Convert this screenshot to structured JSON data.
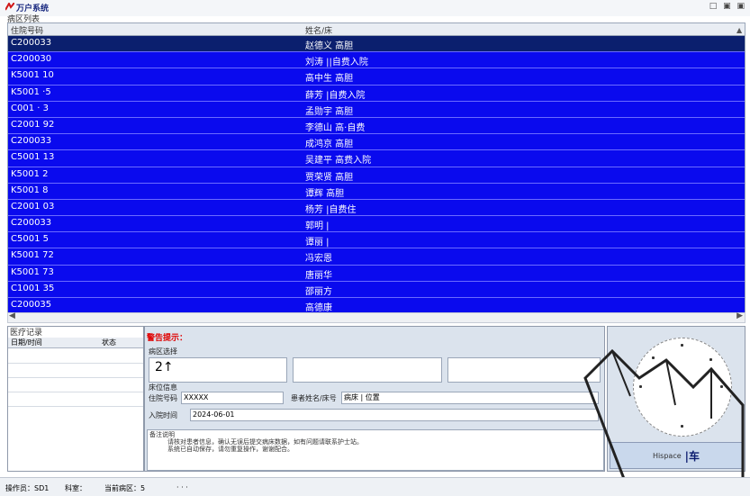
{
  "window": {
    "title": "万户系统",
    "controls": "□ ▣ ▣"
  },
  "list": {
    "group_label": "病区列表",
    "headers": [
      "住院号码",
      "姓名/床"
    ],
    "rows": [
      {
        "id": "C200033",
        "name": "赵德义  高胆",
        "selected": true
      },
      {
        "id": "C200030",
        "name": "刘涛  ||自费入院"
      },
      {
        "id": "K5001 10",
        "name": "高中生  高胆"
      },
      {
        "id": "K5001 ·5",
        "name": "薛芳  |自费入院"
      },
      {
        "id": "C001 · 3",
        "name": "孟勋宇  高胆"
      },
      {
        "id": "C2001 92",
        "name": "李德山  高·自费"
      },
      {
        "id": "C200033",
        "name": "成鸿京  高胆"
      },
      {
        "id": "C5001 13",
        "name": "吴建平  高费入院"
      },
      {
        "id": "K5001 2",
        "name": "贾荣贤  高胆"
      },
      {
        "id": "K5001 8",
        "name": "谭辉  高胆"
      },
      {
        "id": "C2001 03",
        "name": "杨芳  |自费住"
      },
      {
        "id": "C200033",
        "name": "郭明  |"
      },
      {
        "id": "C5001 5",
        "name": "谭丽  |"
      },
      {
        "id": "K5001 72",
        "name": "冯宏恩"
      },
      {
        "id": "K5001 73",
        "name": "唐丽华"
      },
      {
        "id": "C1001 35",
        "name": "邵丽方"
      },
      {
        "id": "C200035",
        "name": "高德康"
      }
    ]
  },
  "left_panel": {
    "title": "医疗记录",
    "col1": "日期/时间",
    "col2": "状态"
  },
  "center_panel": {
    "warning": "警告提示：",
    "section1": "病区选择",
    "value": "2↑",
    "section2": "床位信息",
    "field1_label": "住院号码",
    "field1_value": "XXXXX",
    "field2_label": "患者姓名/床号",
    "field2_value": "病床  |  位置",
    "field3_label": "入院时间",
    "field3_value": "2024-06-01",
    "notes_label": "备注说明",
    "notes_line1": "请核对患者信息，确认无误后提交病床数据，如有问题请联系护士站。",
    "notes_line2": "系统已自动保存，请勿重复操作，谢谢配合。"
  },
  "right_panel": {
    "button_small": "Hispace",
    "button_label": "|车"
  },
  "statusbar": {
    "item1": "操作员：SD1",
    "item2": "科室：",
    "item3": "当前病区：5",
    "item4": "· · ·"
  }
}
